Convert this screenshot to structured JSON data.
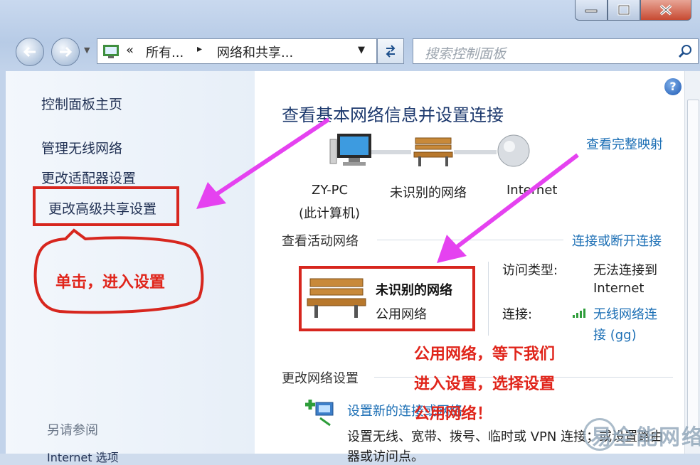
{
  "address": {
    "crumb_prefix": "«",
    "crumb_1": "所有...",
    "crumb_sep": "▸",
    "crumb_2": "网络和共享...",
    "dropdown": "▼"
  },
  "search": {
    "placeholder": "搜索控制面板"
  },
  "sidebar": {
    "items": [
      {
        "label": "控制面板主页"
      },
      {
        "label": "管理无线网络"
      },
      {
        "label": "更改适配器设置"
      },
      {
        "label": "更改高级共享设置"
      }
    ],
    "see_also": "另请参阅",
    "bottom_partial": "Internet 选项"
  },
  "main": {
    "title": "查看基本网络信息并设置连接",
    "view_full_map": "查看完整映射",
    "map_nodes": [
      {
        "line1": "ZY-PC",
        "line2": "(此计算机)"
      },
      {
        "line1": "未识别的网络"
      },
      {
        "line1": "Internet"
      }
    ],
    "active_networks": {
      "heading": "查看活动网络",
      "connect_link": "连接或断开连接",
      "network_name": "未识别的网络",
      "network_type": "公用网络",
      "access_type_label": "访问类型:",
      "access_type_value_1": "无法连接到",
      "access_type_value_2": "Internet",
      "connection_label": "连接:",
      "connection_value_1": "无线网络连",
      "connection_value_2": "接 (gg)"
    },
    "change_settings": {
      "heading": "更改网络设置",
      "setup_link": "设置新的连接或网络",
      "setup_desc_1": "设置无线、宽带、拨号、临时或 VPN 连接；或设置路由",
      "setup_desc_2": "器或访问点。"
    }
  },
  "annotations": {
    "click_hint": "单击，进入设置",
    "note_line_1": "公用网络，等下我们",
    "note_line_2": "进入设置，选择设置",
    "note_line_3": "公用网络！",
    "watermark": "易全能网络"
  },
  "colors": {
    "annotation_red": "#d7261e",
    "arrow_magenta": "#e542f0",
    "link_blue": "#1c6fb5"
  }
}
